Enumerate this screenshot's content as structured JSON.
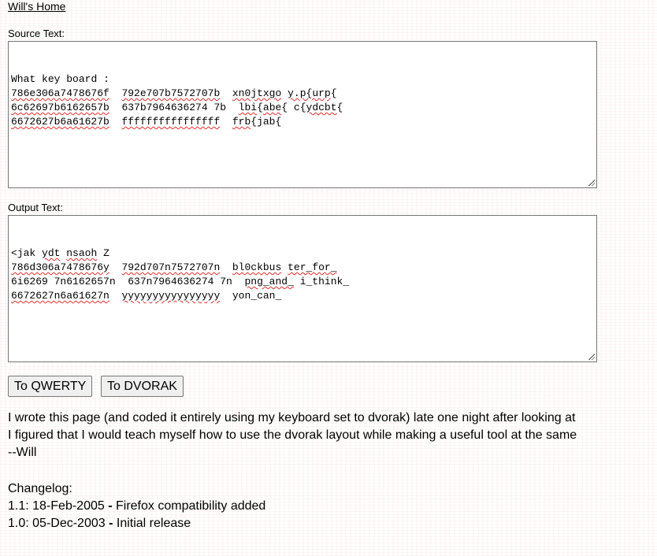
{
  "nav": {
    "home_link": "Will's Home"
  },
  "source": {
    "label": "Source Text:",
    "lines": [
      [
        {
          "t": "What",
          "s": false
        },
        {
          "t": " ",
          "s": false
        },
        {
          "t": "key",
          "s": false
        },
        {
          "t": " ",
          "s": false
        },
        {
          "t": "board",
          "s": false
        },
        {
          "t": " :",
          "s": false
        }
      ],
      [
        {
          "t": "786e306a7478676f",
          "s": true
        },
        {
          "t": "  ",
          "s": false
        },
        {
          "t": "792e707b7572707b",
          "s": true
        },
        {
          "t": "  ",
          "s": false
        },
        {
          "t": "xn0jtxgo",
          "s": true
        },
        {
          "t": " ",
          "s": false
        },
        {
          "t": "y.p{urp",
          "s": true
        },
        {
          "t": "{",
          "s": false
        }
      ],
      [
        {
          "t": "6c62697b6162657b",
          "s": true
        },
        {
          "t": "  ",
          "s": false
        },
        {
          "t": "637b7964636274 7b",
          "s": false
        },
        {
          "t": "  ",
          "s": false
        },
        {
          "t": "lbi",
          "s": true
        },
        {
          "t": "{",
          "s": false
        },
        {
          "t": "abe",
          "s": true
        },
        {
          "t": "{ c{",
          "s": false
        },
        {
          "t": "ydcbt",
          "s": true
        },
        {
          "t": "{",
          "s": false
        }
      ],
      [
        {
          "t": "6672627b6a61627b",
          "s": true
        },
        {
          "t": "  ",
          "s": false
        },
        {
          "t": "ffffffffffffffff",
          "s": true
        },
        {
          "t": "  ",
          "s": false
        },
        {
          "t": "frb",
          "s": true
        },
        {
          "t": "{jab{",
          "s": false
        }
      ]
    ]
  },
  "output": {
    "label": "Output Text:",
    "lines": [
      [
        {
          "t": "<jak",
          "s": false
        },
        {
          "t": " ",
          "s": false
        },
        {
          "t": "ydt",
          "s": true
        },
        {
          "t": " ",
          "s": false
        },
        {
          "t": "nsaoh",
          "s": true
        },
        {
          "t": " Z",
          "s": false
        }
      ],
      [
        {
          "t": "786d306a7478676y",
          "s": true
        },
        {
          "t": "  ",
          "s": false
        },
        {
          "t": "792d707n7572707n",
          "s": true
        },
        {
          "t": "  ",
          "s": false
        },
        {
          "t": "bl0ckbus",
          "s": true
        },
        {
          "t": " ",
          "s": false
        },
        {
          "t": "ter_for_",
          "s": true
        }
      ],
      [
        {
          "t": "6i6269 7n6162657n",
          "s": false
        },
        {
          "t": "  ",
          "s": false
        },
        {
          "t": "637n7964636274 7n",
          "s": false
        },
        {
          "t": "  ",
          "s": false
        },
        {
          "t": "png_and_",
          "s": true
        },
        {
          "t": " ",
          "s": false
        },
        {
          "t": "i_think_",
          "s": false
        }
      ],
      [
        {
          "t": "6672627n6a61627n",
          "s": true
        },
        {
          "t": "  ",
          "s": false
        },
        {
          "t": "yyyyyyyyyyyyyyyy",
          "s": true
        },
        {
          "t": "  ",
          "s": false
        },
        {
          "t": "yon_can_",
          "s": false
        }
      ]
    ]
  },
  "buttons": {
    "to_qwerty": "To QWERTY",
    "to_dvorak": "To DVORAK"
  },
  "body": {
    "line1": "I wrote this page (and coded it entirely using my keyboard set to dvorak) late one night after looking at",
    "line2": "I figured that I would teach myself how to use the dvorak layout while making a useful tool at the same",
    "signature": "--Will"
  },
  "changelog": {
    "title": "Changelog:",
    "entries": [
      {
        "version": "1.1:",
        "date": "18-Feb-2005",
        "dash": "-",
        "note": "Firefox compatibility added"
      },
      {
        "version": "1.0:",
        "date": "05-Dec-2003",
        "dash": "-",
        "note": "Initial release"
      }
    ]
  }
}
